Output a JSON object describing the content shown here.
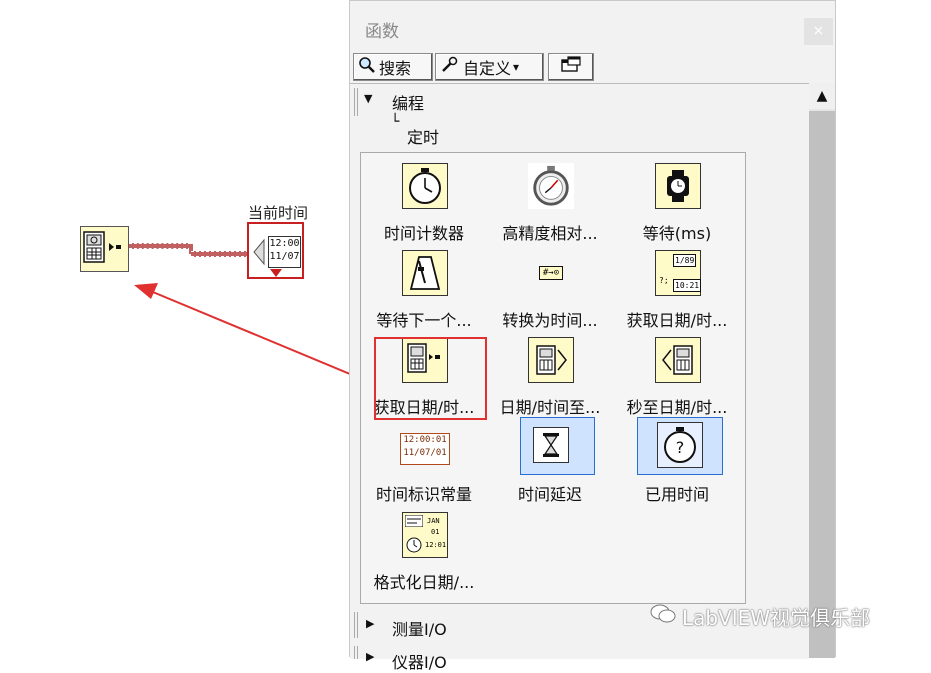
{
  "block_diagram": {
    "indicator_label": "当前时间",
    "indicator_display": [
      "12:00",
      "11/07"
    ]
  },
  "palette": {
    "title": "函数",
    "close_glyph": "×",
    "toolbar": {
      "search_label": "搜索",
      "customize_label": "自定义",
      "customize_arrow": "▾"
    },
    "tree": {
      "category": "编程",
      "subcategory_prefix": "└",
      "subcategory": "定时",
      "collapsed_items": [
        "测量I/O",
        "仪器I/O"
      ]
    },
    "functions": [
      {
        "label": "时间计数器",
        "icon": "stopwatch-icon"
      },
      {
        "label": "高精度相对...",
        "icon": "precision-clock-icon"
      },
      {
        "label": "等待(ms)",
        "icon": "watch-icon"
      },
      {
        "label": "等待下一个...",
        "icon": "metronome-icon"
      },
      {
        "label": "转换为时间...",
        "icon": "convert-time-icon"
      },
      {
        "label": "获取日期/时...",
        "icon": "date-time-string-icon"
      },
      {
        "label": "获取日期/时...",
        "icon": "get-date-time-seconds-icon"
      },
      {
        "label": "日期/时间至...",
        "icon": "date-time-to-seconds-icon"
      },
      {
        "label": "秒至日期/时...",
        "icon": "seconds-to-date-time-icon"
      },
      {
        "label": "时间标识常量",
        "icon": "time-stamp-constant-icon",
        "display": [
          "12:00:01",
          "11/07/01"
        ]
      },
      {
        "label": "时间延迟",
        "icon": "hourglass-icon"
      },
      {
        "label": "已用时间",
        "icon": "elapsed-time-icon"
      },
      {
        "label": "格式化日期/...",
        "icon": "format-date-time-icon",
        "display": [
          "JAN",
          "01",
          "12:01"
        ]
      }
    ],
    "small_texts": {
      "convert_icon_text": "#→⊙",
      "date_icon_text_1": "1/89",
      "date_icon_text_2": "10:21",
      "date_icon_text_3": "?;"
    }
  },
  "watermark": "LabVIEW视觉俱乐部",
  "colors": {
    "wire": "#c06060",
    "annotation_red": "#e03030",
    "highlight_blue": "#2a6fd6"
  }
}
